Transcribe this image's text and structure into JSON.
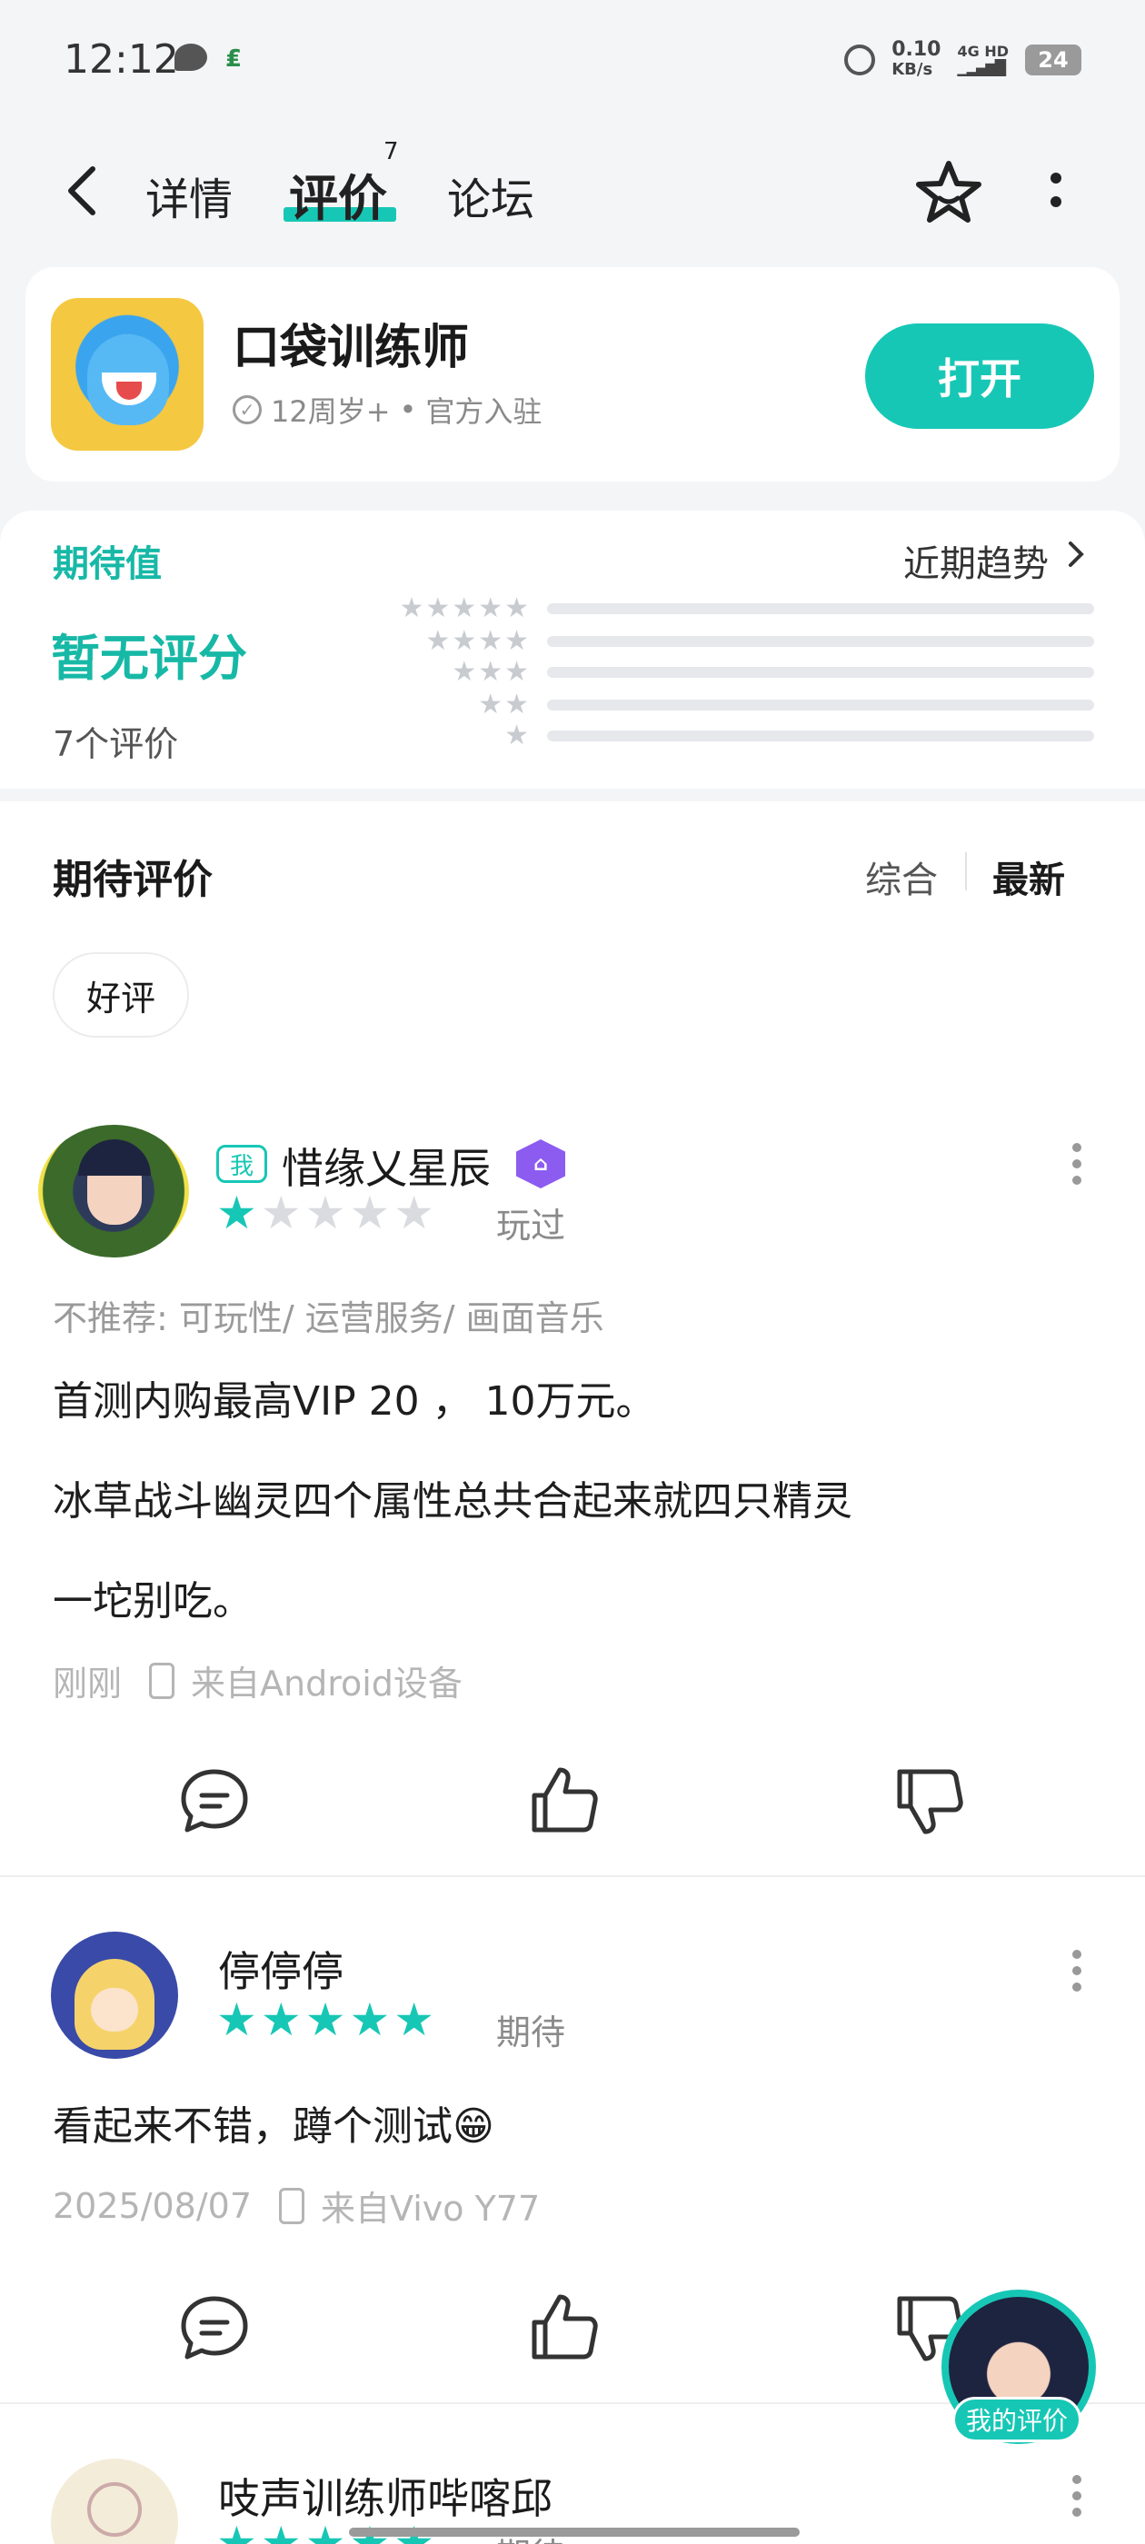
{
  "status_bar": {
    "time": "12:12",
    "net_speed": "0.10",
    "net_unit": "KB/s",
    "signal": "4G HD",
    "battery": "24"
  },
  "header": {
    "tabs": [
      {
        "label": "详情"
      },
      {
        "label": "评价",
        "badge": "7",
        "active": true
      },
      {
        "label": "论坛"
      }
    ]
  },
  "app": {
    "name": "口袋训练师",
    "age_rating": "12周岁+",
    "separator": "•",
    "official": "官方入驻",
    "open_label": "打开"
  },
  "rating": {
    "label": "期待值",
    "trend_label": "近期趋势",
    "score_text": "暂无评分",
    "count_text": "7个评价",
    "star_rows": [
      "★★★★★",
      "★★★★",
      "★★★",
      "★★",
      "★"
    ]
  },
  "reviews_section": {
    "title": "期待评价",
    "sort_options": [
      "综合",
      "最新"
    ],
    "active_sort": "最新",
    "filter_chip": "好评"
  },
  "reviews": [
    {
      "me_badge": "我",
      "username": "惜缘乂星辰",
      "rating": 1,
      "status": "玩过",
      "tags": "不推荐: 可玩性/ 运营服务/ 画面音乐",
      "lines": [
        "首测内购最高VIP 20 ， 10万元。",
        "冰草战斗幽灵四个属性总共合起来就四只精灵",
        "一坨别吃。"
      ],
      "time": "刚刚",
      "device": "来自Android设备"
    },
    {
      "username": "停停停",
      "rating": 5,
      "status": "期待",
      "lines": [
        "看起来不错，蹲个测试😁"
      ],
      "time": "2025/08/07",
      "device": "来自Vivo Y77"
    },
    {
      "username": "吱声训练师哔喀邱",
      "status": "期待"
    }
  ],
  "floating": {
    "my_review_label": "我的评价"
  },
  "colors": {
    "accent": "#17c7b5",
    "badge_purple": "#8c5cf0"
  }
}
